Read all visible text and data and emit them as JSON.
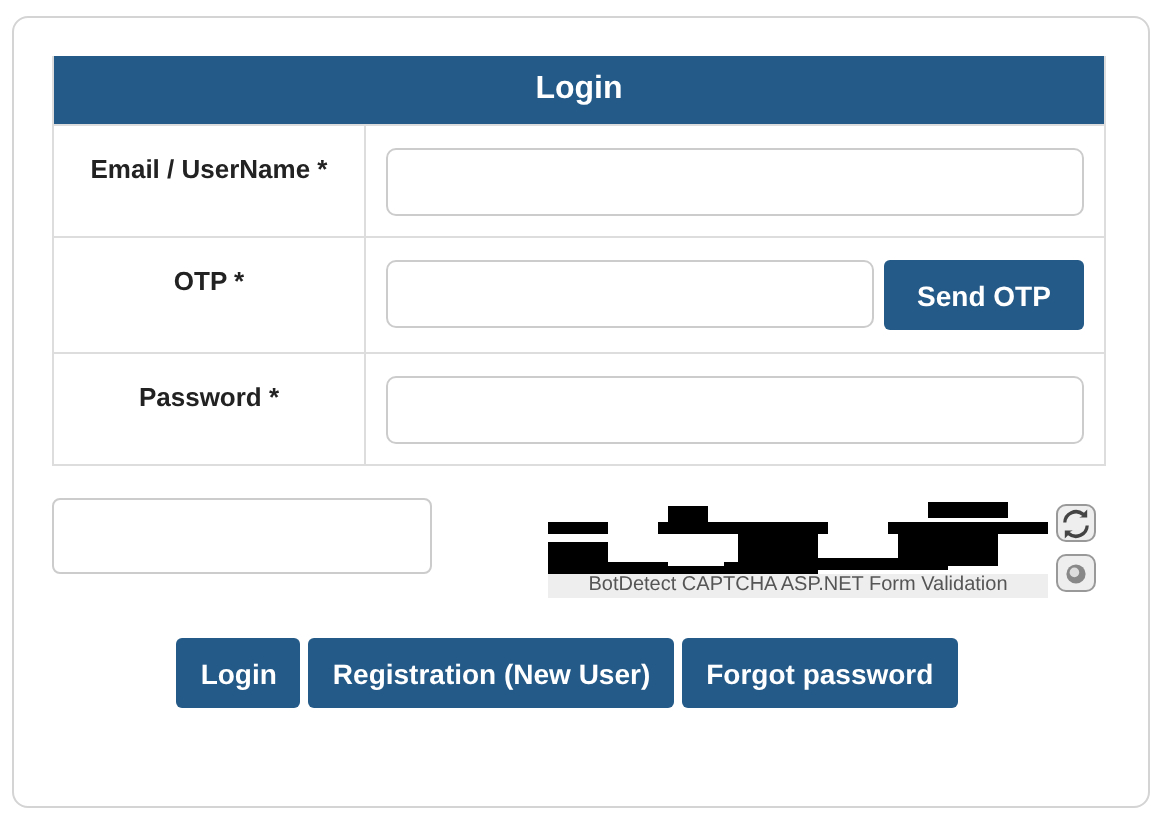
{
  "form": {
    "title": "Login",
    "fields": [
      {
        "label": "Email / UserName *",
        "kind": "text"
      },
      {
        "label": "OTP *",
        "kind": "otp",
        "button": "Send OTP"
      },
      {
        "label": "Password *",
        "kind": "password"
      }
    ]
  },
  "captcha": {
    "caption": "BotDetect CAPTCHA ASP.NET Form Validation"
  },
  "buttons": [
    "Login",
    "Registration (New User)",
    "Forgot password"
  ]
}
